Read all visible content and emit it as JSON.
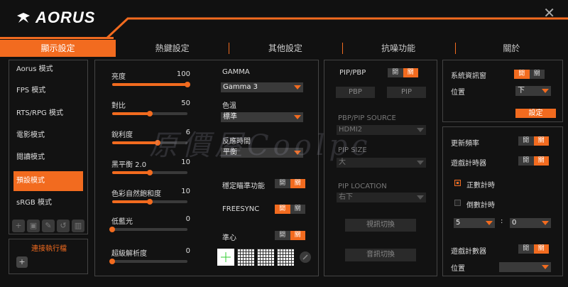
{
  "app": {
    "brand": "AORUS",
    "close_glyph": "✕"
  },
  "tabs": [
    "顯示設定",
    "熱鍵設定",
    "其他設定",
    "抗噪功能",
    "關於"
  ],
  "sidebar": {
    "items": [
      "Aorus 模式",
      "FPS 模式",
      "RTS/RPG 模式",
      "電影模式",
      "閱讀模式",
      "預設模式",
      "sRGB 模式"
    ],
    "active_index": 5,
    "tool_icons": [
      "+",
      "▣",
      "✎",
      "↺",
      "▥"
    ],
    "link_label": "連接執行檔",
    "add_glyph": "+"
  },
  "sliders": [
    {
      "label": "亮度",
      "value": "100",
      "level": 1.0
    },
    {
      "label": "對比",
      "value": "50",
      "level": 0.5
    },
    {
      "label": "銳利度",
      "value": "6",
      "level": 0.6
    },
    {
      "label": "黑平衡 2.0",
      "value": "10",
      "level": 0.5
    },
    {
      "label": "色彩自然飽和度",
      "value": "10",
      "level": 0.5
    },
    {
      "label": "低藍光",
      "value": "0",
      "level": 0.0
    },
    {
      "label": "超級解析度",
      "value": "0",
      "level": 0.0
    }
  ],
  "mid": {
    "gamma_label": "GAMMA",
    "gamma_value": "Gamma 3",
    "color_temp_label": "色溫",
    "color_temp_value": "標準",
    "response_label": "反應時間",
    "response_value": "平衡",
    "aim_label": "穩定瞄準功能",
    "freesync_label": "FREESYNC",
    "crosshair_label": "準心"
  },
  "toggle": {
    "on": "開",
    "off": "關"
  },
  "pip": {
    "title": "PIP/PBP",
    "pbp_btn": "PBP",
    "pip_btn": "PIP",
    "source_label": "PBP/PIP SOURCE",
    "source_value": "HDMI2",
    "size_label": "PIP SIZE",
    "size_value": "大",
    "location_label": "PIP LOCATION",
    "location_value": "右下",
    "switch_video": "視訊切換",
    "switch_audio": "音訊切換"
  },
  "right": {
    "sysinfo_label": "系統資訊窗",
    "position_label": "位置",
    "position_value": "下",
    "settings_btn": "設定",
    "refresh_label": "更新頻率",
    "timer_label": "遊戲計時器",
    "countup_label": "正數計時",
    "countdown_label": "倒數計時",
    "min_value": "5",
    "colon": ":",
    "sec_value": "0",
    "counter_label": "遊戲計數器",
    "counter_pos_label": "位置",
    "counter_pos_value": ""
  },
  "watermark": "原價屋Coolpc",
  "colors": {
    "accent": "#f26b1f",
    "bg": "#111111"
  }
}
